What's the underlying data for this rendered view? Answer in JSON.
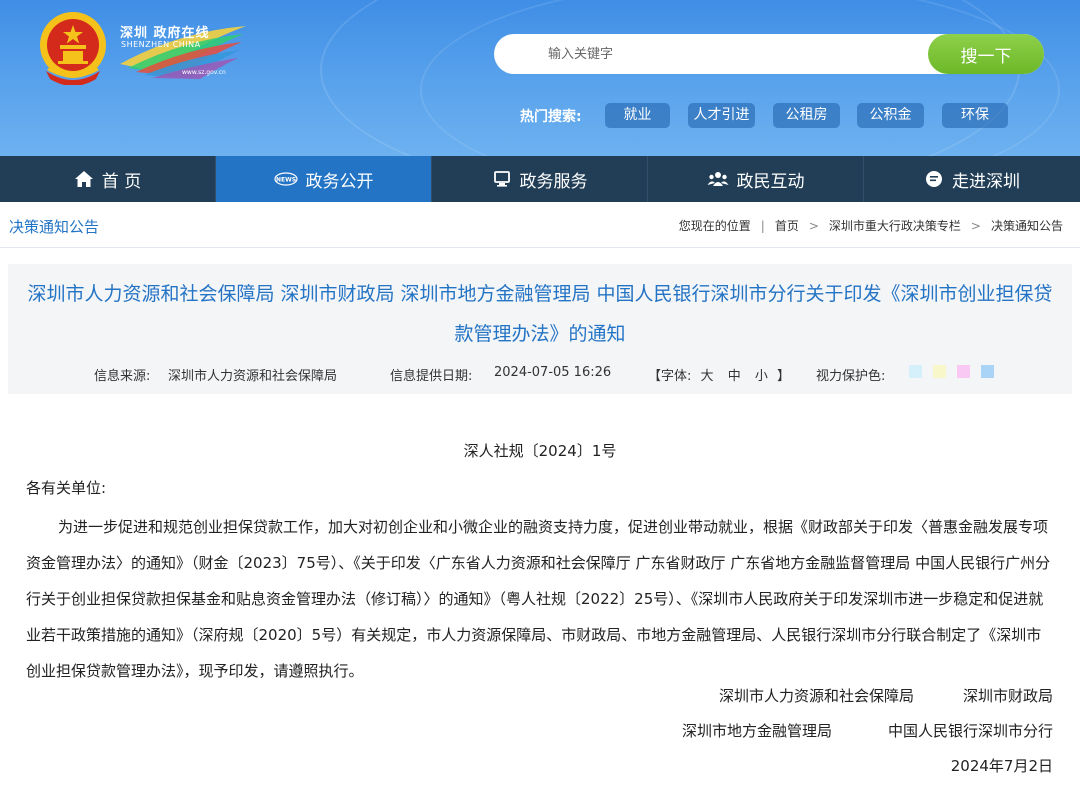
{
  "header": {
    "site_logo_zh": "深圳 政府在线",
    "site_logo_en": "SHENZHEN CHINA",
    "site_url": "www.sz.gov.cn",
    "search_placeholder": "输入关键字",
    "search_button": "搜一下",
    "hot_label": "热门搜索:",
    "hot_tags": [
      "就业",
      "人才引进",
      "公租房",
      "公积金",
      "环保"
    ]
  },
  "nav": {
    "items": [
      {
        "label": "首 页",
        "icon": "home-icon"
      },
      {
        "label": "政务公开",
        "icon": "news-icon"
      },
      {
        "label": "政务服务",
        "icon": "monitor-icon"
      },
      {
        "label": "政民互动",
        "icon": "people-icon"
      },
      {
        "label": "走进深圳",
        "icon": "chat-icon"
      }
    ],
    "active_index": 1
  },
  "crumb_bar": {
    "section_title": "决策通知公告",
    "location_label": "您现在的位置",
    "crumbs": [
      "首页",
      "深圳市重大行政决策专栏",
      "决策通知公告"
    ]
  },
  "article": {
    "title": "深圳市人力资源和社会保障局 深圳市财政局 深圳市地方金融管理局 中国人民银行深圳市分行关于印发《深圳市创业担保贷款管理办法》的通知",
    "source_label": "信息来源:",
    "source_value": "深圳市人力资源和社会保障局",
    "date_label": "信息提供日期:",
    "date_value": "2024-07-05 16:26",
    "font_label_open": "【字体:",
    "font_large": "大",
    "font_medium": "中",
    "font_small": "小",
    "font_label_close": "】",
    "eye_care_label": "视力保护色:",
    "eye_care_colors": [
      "#d5f0fb",
      "#f7f7c9",
      "#f9c8f3",
      "#a9d3f7"
    ],
    "doc_number": "深人社规〔2024〕1号",
    "salutation": "各有关单位:",
    "body": "为进一步促进和规范创业担保贷款工作，加大对初创企业和小微企业的融资支持力度，促进创业带动就业，根据《财政部关于印发〈普惠金融发展专项资金管理办法〉的通知》（财金〔2023〕75号）、《关于印发〈广东省人力资源和社会保障厅 广东省财政厅 广东省地方金融监督管理局 中国人民银行广州分行关于创业担保贷款担保基金和贴息资金管理办法（修订稿）〉的通知》（粤人社规〔2022〕25号）、《深圳市人民政府关于印发深圳市进一步稳定和促进就业若干政策措施的通知》（深府规〔2020〕5号）有关规定，市人力资源保障局、市财政局、市地方金融管理局、人民银行深圳市分行联合制定了《深圳市创业担保贷款管理办法》，现予印发，请遵照执行。",
    "signers_row1": [
      "深圳市人力资源和社会保障局",
      "深圳市财政局"
    ],
    "signers_row2": [
      "深圳市地方金融管理局",
      "中国人民银行深圳市分行"
    ],
    "sign_date": "2024年7月2日"
  },
  "colors": {
    "header_blue": "#4d9aea",
    "nav_bg": "#213e56",
    "nav_active": "#2474c5",
    "title_blue": "#2474c5",
    "search_green": "#7cc53a"
  }
}
